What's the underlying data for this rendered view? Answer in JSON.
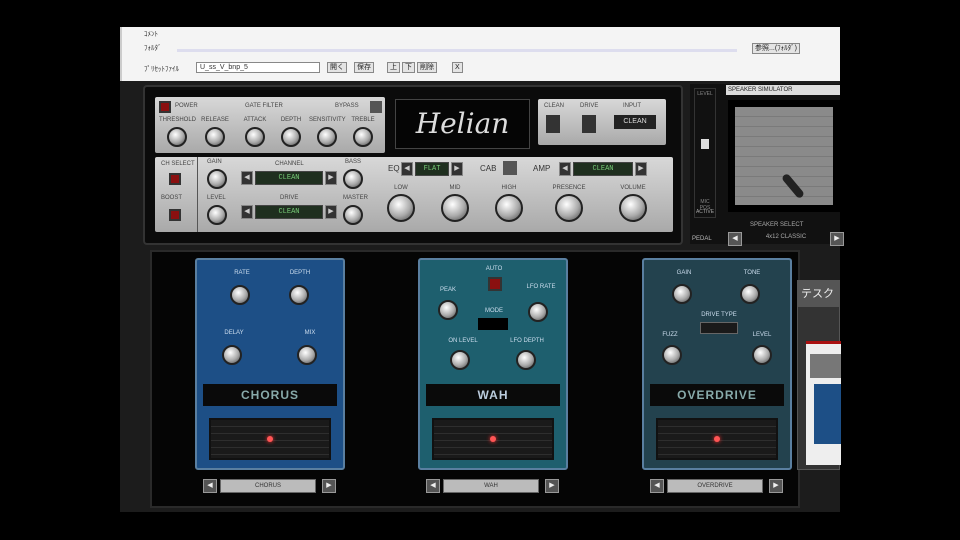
{
  "toolbar": {
    "row1_label": "ｺﾒﾝﾄ",
    "row2_label": "ﾌｫﾙﾀﾞ",
    "row3_label": "ﾌﾟﾘｾｯﾄﾌｧｲﾙ",
    "folder_button": "参照...(ﾌｫﾙﾀﾞ)",
    "preset_select": "U_ss_V_bnp_5",
    "btn_open": "開く",
    "btn_save": "保存",
    "btn_up": "上",
    "btn_down": "下",
    "btn_delete": "削除",
    "btn_x": "X"
  },
  "amp": {
    "logo": "Helian",
    "power_label": "POWER",
    "gate_title": "GATE FILTER",
    "bypass_label": "BYPASS",
    "top_knobs": [
      "THRESHOLD",
      "RELEASE",
      "ATTACK",
      "DEPTH",
      "SENSITIVITY",
      "TREBLE"
    ],
    "switch_labels": [
      "CLEAN",
      "DRIVE",
      "INPUT"
    ],
    "input_value": "CLEAN",
    "left_leds": [
      "CH SELECT",
      "BOOST"
    ],
    "left_knobs": [
      "GAIN",
      "LEVEL"
    ],
    "lcd1_label": "CHANNEL",
    "lcd1_value": "CLEAN",
    "lcd2_label": "DRIVE",
    "lcd2_value": "CLEAN",
    "right_small_knobs": [
      "BASS",
      "MASTER"
    ],
    "eq_label": "EQ",
    "cab_label": "CAB",
    "amp_label": "AMP",
    "eq_value": "FLAT",
    "amp_value": "CLEAN",
    "main_knobs": [
      "LOW",
      "MID",
      "HIGH",
      "PRESENCE",
      "VOLUME"
    ]
  },
  "side": {
    "title": "SPEAKER SIMULATOR",
    "slider_label": "LEVEL",
    "slider_sub": "MIC POS",
    "mode": "ACTIVE",
    "speaker_select_label": "SPEAKER SELECT",
    "speaker_value": "4x12 CLASSIC",
    "pedal_label": "PEDAL"
  },
  "pedals": [
    {
      "name": "CHORUS",
      "knobs": [
        "RATE",
        "DEPTH",
        "DELAY",
        "MIX"
      ],
      "select": "CHORUS",
      "color": "#1d4f86"
    },
    {
      "name": "WAH",
      "knobs": [
        "PEAK",
        "LFO RATE",
        "ON LEVEL",
        "LFO DEPTH"
      ],
      "extra": "AUTO",
      "switch": "MODE",
      "select": "WAH",
      "color": "#1e5f6e"
    },
    {
      "name": "OVERDRIVE",
      "knobs": [
        "GAIN",
        "TONE",
        "FUZZ",
        "LEVEL"
      ],
      "switch": "DRIVE TYPE",
      "select": "OVERDRIVE",
      "color": "#23424e"
    }
  ],
  "taskbar_popup": {
    "title": "テスク"
  }
}
